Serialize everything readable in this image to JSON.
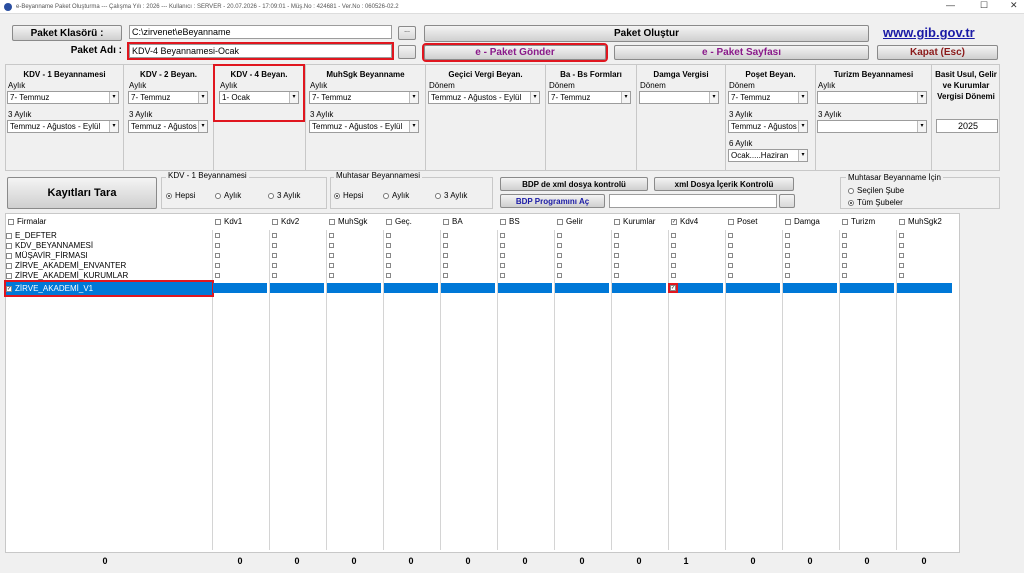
{
  "window": {
    "title": "e-Beyanname Paket Oluşturma  ---  Çalışma Yılı : 2026  ---  Kullanıcı : SERVER - 20.07.2026 - 17:09:01 - Müş.No : 424681 - Ver.No : 060526-02.2",
    "minimize": "—",
    "maximize": "☐",
    "close": "✕"
  },
  "top": {
    "paket_klasoru_btn": "Paket Klasörü :",
    "paket_klasoru_value": "C:\\zirvenet\\eBeyanname",
    "paket_adi_label": "Paket Adı :",
    "paket_adi_value": "KDV-4 Beyannamesi-Ocak",
    "paket_olustur": "Paket Oluştur",
    "paket_gonder": "e - Paket Gönder",
    "paket_sayfasi": "e - Paket Sayfası",
    "kapat": "Kapat (Esc)",
    "gib_link": "www.gib.gov.tr",
    "dots": "..."
  },
  "decl": {
    "kdv1": {
      "title": "KDV - 1 Beyannamesi",
      "l1": "Aylık",
      "v1": "7- Temmuz",
      "l2": "3 Aylık",
      "v2": "Temmuz - Ağustos - Eylül"
    },
    "kdv2": {
      "title": "KDV - 2 Beyan.",
      "l1": "Aylık",
      "v1": "7- Temmuz",
      "l2": "3 Aylık",
      "v2": "Temmuz - Ağustos"
    },
    "kdv4": {
      "title": "KDV - 4 Beyan.",
      "l1": "Aylık",
      "v1": "1- Ocak"
    },
    "muhsgk": {
      "title": "MuhSgk Beyanname",
      "l1": "Aylık",
      "v1": "7- Temmuz",
      "l2": "3 Aylık",
      "v2": "Temmuz - Ağustos - Eylül"
    },
    "gecici": {
      "title": "Geçici Vergi Beyan.",
      "l1": "Dönem",
      "v1": "Temmuz - Ağustos - Eylül"
    },
    "babs": {
      "title": "Ba - Bs Formları",
      "l1": "Dönem",
      "v1": "7- Temmuz"
    },
    "damga": {
      "title": "Damga Vergisi",
      "l1": "Dönem",
      "v1": ""
    },
    "poset": {
      "title": "Poşet Beyan.",
      "l1": "Dönem",
      "v1": "7- Temmuz",
      "l2": "3 Aylık",
      "v2": "Temmuz - Ağustos",
      "l3": "6 Aylık",
      "v3": "Ocak.....Haziran"
    },
    "turizm": {
      "title": "Turizm Beyannamesi",
      "l1": "Aylık",
      "v1": "",
      "l2": "3 Aylık",
      "v2": ""
    },
    "basit": {
      "title1": "Basit Usul, Gelir",
      "title2": "ve Kurumlar",
      "title3": "Vergisi Dönemi",
      "year": "2025"
    }
  },
  "mid": {
    "kayitlari_tara": "Kayıtları Tara",
    "kdv1_group": "KDV - 1 Beyannamesi",
    "muh_group": "Muhtasar Beyannamesi",
    "hepsi": "Hepsi",
    "aylik": "Aylık",
    "uc_aylik": "3 Aylık",
    "bdp_xml": "BDP de xml dosya kontrolü",
    "xml_icerik": "xml Dosya İçerik Kontrolü",
    "bdp_ac": "BDP Programını Aç",
    "muh_icin": "Muhtasar Beyanname İçin",
    "secilen_sube": "Seçilen Şube",
    "tum_subeler": "Tüm Şubeler"
  },
  "grid": {
    "columns": [
      "Firmalar",
      "Kdv1",
      "Kdv2",
      "MuhSgk",
      "Geç.",
      "BA",
      "BS",
      "Gelir",
      "Kurumlar",
      "Kdv4",
      "Poset",
      "Damga",
      "Turizm",
      "MuhSgk2"
    ],
    "firms": [
      "E_DEFTER",
      "KDV_BEYANNAMESİ",
      "MÜŞAVİR_FİRMASI",
      "ZİRVE_AKADEMİ_ENVANTER",
      "ZİRVE_AKADEMİ_KURUMLAR",
      "ZİRVE_AKADEMİ_V1"
    ],
    "selected_firm": "ZİRVE_AKADEMİ_V1",
    "totals": [
      "0",
      "0",
      "0",
      "0",
      "0",
      "0",
      "0",
      "0",
      "0",
      "1",
      "0",
      "0",
      "0",
      "0"
    ]
  },
  "colors": {
    "selection": "#0078d7",
    "highlight": "#e0161f",
    "link": "#1a1aa6",
    "purple": "#8a1a8a",
    "maroon": "#8b1a1a"
  }
}
